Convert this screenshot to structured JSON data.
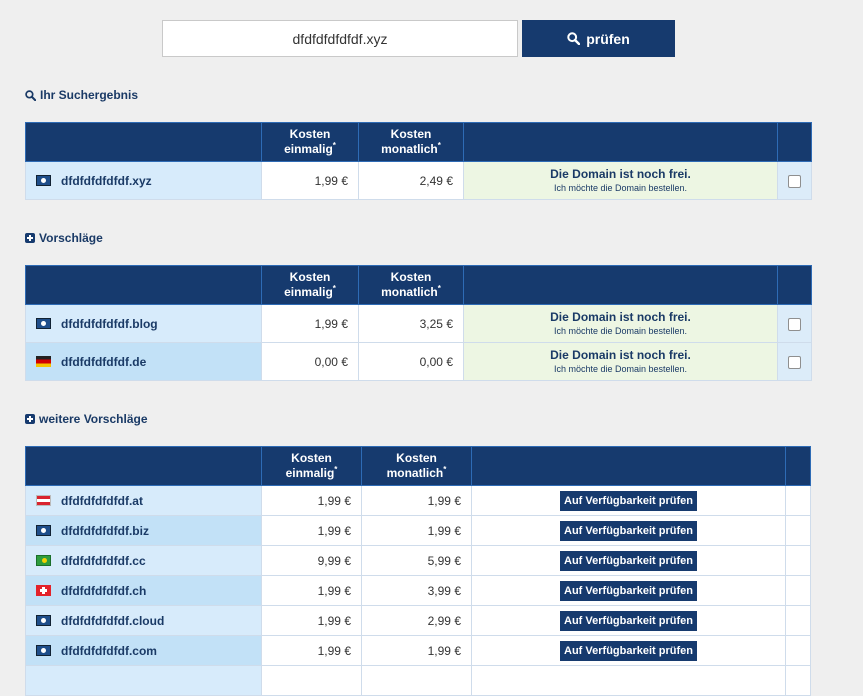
{
  "search": {
    "value": "dfdfdfdfdfdf.xyz",
    "button_label": "prüfen"
  },
  "sections": {
    "result_title": "Ihr Suchergebnis",
    "suggestions_title": "Vorschläge",
    "more_title": "weitere Vorschläge"
  },
  "table_headers": {
    "cost_once": "Kosten",
    "cost_once_sub": "einmalig",
    "cost_monthly": "Kosten",
    "cost_monthly_sub": "monatlich",
    "footnote_mark": "*"
  },
  "result": [
    {
      "domain": "dfdfdfdfdfdf.xyz",
      "flag": "globe-icon",
      "once": "1,99 €",
      "monthly": "2,49 €",
      "status": "Die Domain ist noch frei.",
      "status_sub": "Ich möchte die Domain bestellen."
    }
  ],
  "suggestions": [
    {
      "domain": "dfdfdfdfdfdf.blog",
      "flag": "globe-icon",
      "once": "1,99 €",
      "monthly": "3,25 €",
      "status": "Die Domain ist noch frei.",
      "status_sub": "Ich möchte die Domain bestellen."
    },
    {
      "domain": "dfdfdfdfdfdf.de",
      "flag": "germany-flag-icon",
      "once": "0,00 €",
      "monthly": "0,00 €",
      "status": "Die Domain ist noch frei.",
      "status_sub": "Ich möchte die Domain bestellen."
    }
  ],
  "more": [
    {
      "domain": "dfdfdfdfdfdf.at",
      "flag": "austria-flag-icon",
      "once": "1,99 €",
      "monthly": "1,99 €",
      "action": "Auf Verfügbarkeit prüfen"
    },
    {
      "domain": "dfdfdfdfdfdf.biz",
      "flag": "globe-icon",
      "once": "1,99 €",
      "monthly": "1,99 €",
      "action": "Auf Verfügbarkeit prüfen"
    },
    {
      "domain": "dfdfdfdfdfdf.cc",
      "flag": "cocos-islands-flag-icon",
      "once": "9,99 €",
      "monthly": "5,99 €",
      "action": "Auf Verfügbarkeit prüfen"
    },
    {
      "domain": "dfdfdfdfdfdf.ch",
      "flag": "switzerland-flag-icon",
      "once": "1,99 €",
      "monthly": "3,99 €",
      "action": "Auf Verfügbarkeit prüfen"
    },
    {
      "domain": "dfdfdfdfdfdf.cloud",
      "flag": "globe-icon",
      "once": "1,99 €",
      "monthly": "2,99 €",
      "action": "Auf Verfügbarkeit prüfen"
    },
    {
      "domain": "dfdfdfdfdfdf.com",
      "flag": "globe-icon",
      "once": "1,99 €",
      "monthly": "1,99 €",
      "action": "Auf Verfügbarkeit prüfen"
    }
  ],
  "colors": {
    "header": "#163a6e",
    "name_cell": "#d7ebfb",
    "status_cell": "#edf6e3"
  }
}
